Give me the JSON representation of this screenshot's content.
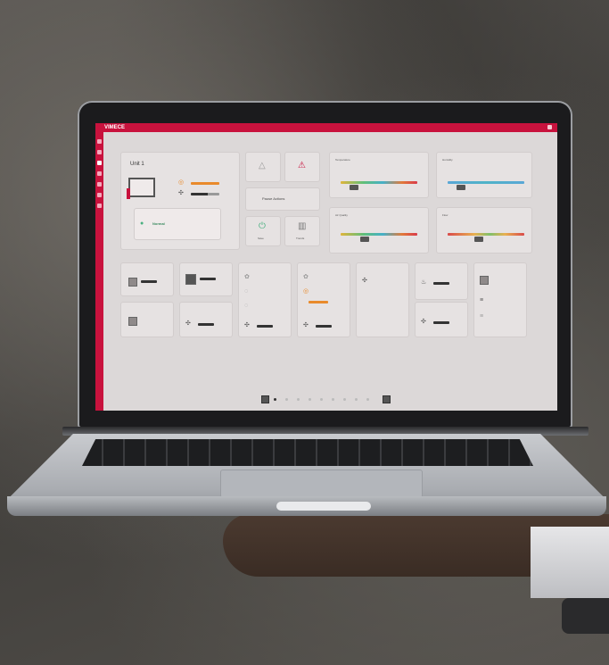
{
  "app": {
    "brand": "VIMECE",
    "accent_color": "#c8123d"
  },
  "unit_card": {
    "title": "Unit 1",
    "status": "Normal",
    "status_button_label": "Pause Actions"
  },
  "actions": {
    "save_label": "Save",
    "trends_label": "Trends"
  },
  "gauges": [
    {
      "title": "Temperature"
    },
    {
      "title": "Humidity"
    },
    {
      "title": "Air Quality"
    },
    {
      "title": "Flow"
    }
  ],
  "pager": {
    "page_count": 9,
    "current_index": 0
  },
  "icons": [
    "warning-icon",
    "alarm-icon",
    "power-icon",
    "chart-icon",
    "fan-icon",
    "thermometer-icon",
    "heater-icon"
  ]
}
